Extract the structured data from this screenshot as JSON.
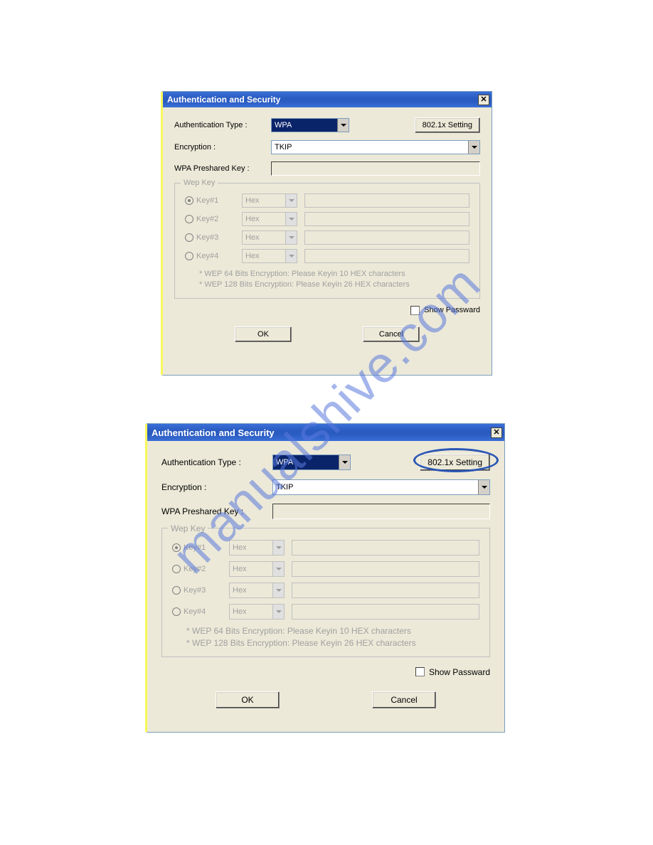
{
  "watermark": "manualshive.com",
  "dialog_small": {
    "title": "Authentication and Security",
    "auth_label": "Authentication Type :",
    "auth_value": "WPA",
    "btn_802": "802.1x Setting",
    "enc_label": "Encryption :",
    "enc_value": "TKIP",
    "psk_label": "WPA Preshared Key :",
    "wep_legend": "Wep Key",
    "keys": [
      {
        "label": "Key#1",
        "fmt": "Hex",
        "checked": true
      },
      {
        "label": "Key#2",
        "fmt": "Hex",
        "checked": false
      },
      {
        "label": "Key#3",
        "fmt": "Hex",
        "checked": false
      },
      {
        "label": "Key#4",
        "fmt": "Hex",
        "checked": false
      }
    ],
    "hint1": "* WEP 64 Bits Encryption:   Please Keyin 10 HEX characters",
    "hint2": "* WEP 128 Bits Encryption:   Please Keyin 26 HEX characters",
    "show_pw": "Show Passward",
    "ok": "OK",
    "cancel": "Cancel"
  },
  "dialog_large": {
    "title": "Authentication and Security",
    "auth_label": "Authentication Type :",
    "auth_value": "WPA",
    "btn_802": "802.1x Setting",
    "enc_label": "Encryption :",
    "enc_value": "TKIP",
    "psk_label": "WPA Preshared Key :",
    "wep_legend": "Wep Key",
    "keys": [
      {
        "label": "Key#1",
        "fmt": "Hex",
        "checked": true
      },
      {
        "label": "Key#2",
        "fmt": "Hex",
        "checked": false
      },
      {
        "label": "Key#3",
        "fmt": "Hex",
        "checked": false
      },
      {
        "label": "Key#4",
        "fmt": "Hex",
        "checked": false
      }
    ],
    "hint1": "* WEP 64 Bits Encryption:   Please Keyin 10 HEX characters",
    "hint2": "* WEP 128 Bits Encryption:   Please Keyin 26 HEX characters",
    "show_pw": "Show Passward",
    "ok": "OK",
    "cancel": "Cancel"
  }
}
